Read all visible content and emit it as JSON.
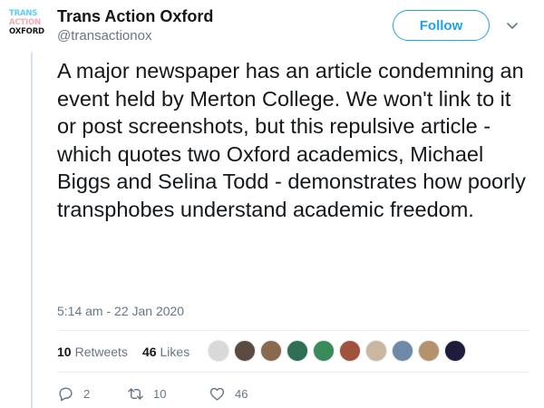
{
  "account": {
    "logo_lines": [
      "TRANS",
      "ACTION",
      "OXFORD"
    ],
    "logo_colors": [
      "#5bcefa",
      "#f5a9b8",
      "#14171a"
    ],
    "name": "Trans Action Oxford",
    "handle": "@transactionox",
    "follow_label": "Follow"
  },
  "tweet": {
    "text": "A major newspaper has an article condemning an event held by Merton College. We won't link to it or post screenshots, but this repulsive article - which quotes two Oxford academics, Michael Biggs and Selina Todd - demonstrates how poorly transphobes understand academic freedom.",
    "timestamp": "5:14 am - 22 Jan 2020"
  },
  "stats": {
    "retweets_count": "10",
    "retweets_label": "Retweets",
    "likes_count": "46",
    "likes_label": "Likes"
  },
  "liker_avatars": [
    {
      "color": "#d9d9d9"
    },
    {
      "color": "#5b4a3f"
    },
    {
      "color": "#8a6a4e"
    },
    {
      "color": "#2e6f55"
    },
    {
      "color": "#3b8a5a"
    },
    {
      "color": "#a0523d"
    },
    {
      "color": "#c9b7a0"
    },
    {
      "color": "#6f8aa8"
    },
    {
      "color": "#b4926b"
    },
    {
      "color": "#1f1b3a"
    }
  ],
  "actions": {
    "reply_count": "2",
    "retweet_count": "10",
    "like_count": "46"
  },
  "colors": {
    "accent": "#1da1f2",
    "secondary_text": "#657786",
    "thread_line": "#cfe3f4"
  }
}
